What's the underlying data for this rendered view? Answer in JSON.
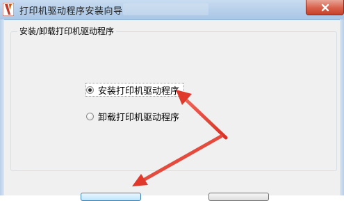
{
  "window": {
    "title": "打印机驱动程序安装向导"
  },
  "group": {
    "label": "安装/卸载打印机驱动程序"
  },
  "options": [
    {
      "label": "安装打印机驱动程序",
      "selected": true
    },
    {
      "label": "卸载打印机驱动程序",
      "selected": false
    }
  ],
  "colors": {
    "arrow": "#e53d2f",
    "titlebar": "#b6cfea",
    "close_button": "#d8604a"
  },
  "icons": {
    "app": "app-logo-icon",
    "close": "close-icon"
  }
}
